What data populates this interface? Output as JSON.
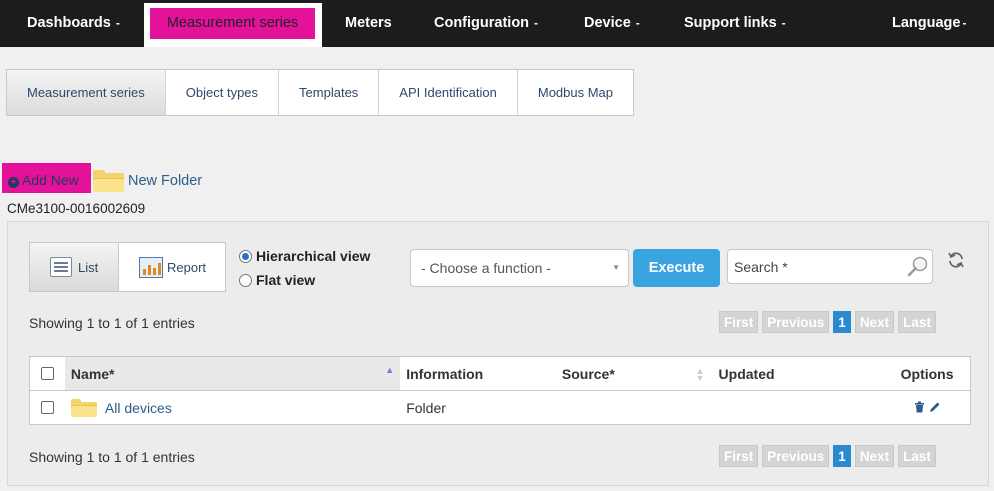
{
  "nav": {
    "items": [
      {
        "label": "Dashboards",
        "dropdown": true
      },
      {
        "label": "Measurement series",
        "dropdown": false,
        "active": true
      },
      {
        "label": "Meters",
        "dropdown": false
      },
      {
        "label": "Configuration",
        "dropdown": true
      },
      {
        "label": "Device",
        "dropdown": true
      },
      {
        "label": "Support links",
        "dropdown": true
      },
      {
        "label": "Language",
        "dropdown": true
      }
    ],
    "caret": "-"
  },
  "subtabs": [
    "Measurement series",
    "Object types",
    "Templates",
    "API Identification",
    "Modbus Map"
  ],
  "actions": {
    "add_new": "Add New",
    "new_folder": "New Folder"
  },
  "device_id": "CMe3100-0016002609",
  "view": {
    "list_label": "List",
    "report_label": "Report",
    "hierarchical_label": "Hierarchical view",
    "flat_label": "Flat view",
    "selected": "hierarchical"
  },
  "function_select": {
    "value": "- Choose a function -"
  },
  "execute_label": "Execute",
  "search": {
    "placeholder": "Search *"
  },
  "showing_text": "Showing 1 to 1 of 1 entries",
  "pager": {
    "first": "First",
    "previous": "Previous",
    "current": "1",
    "next": "Next",
    "last": "Last"
  },
  "table": {
    "columns": {
      "name": "Name*",
      "information": "Information",
      "source": "Source*",
      "updated": "Updated",
      "options": "Options"
    },
    "rows": [
      {
        "name": "All devices",
        "information": "Folder",
        "source": "",
        "updated": ""
      }
    ]
  },
  "colors": {
    "accent_magenta": "#e4119b",
    "nav_bg": "#1c1c1c",
    "execute_blue": "#3aa4e0",
    "page_current": "#2a8ad0"
  }
}
